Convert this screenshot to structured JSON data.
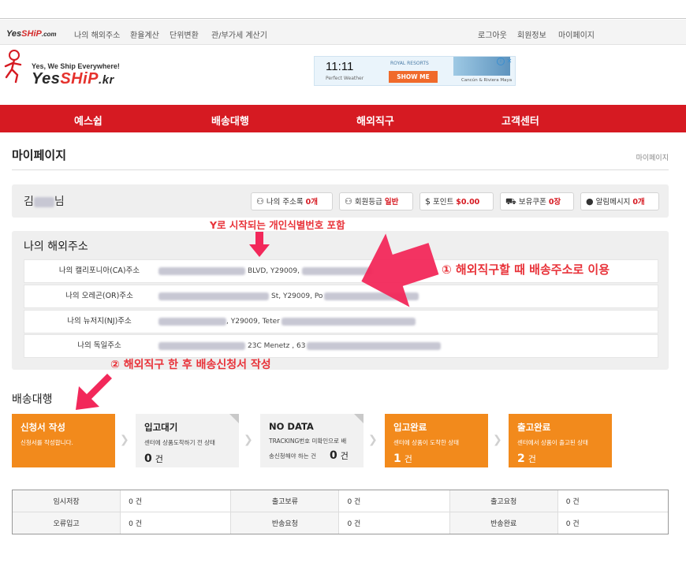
{
  "util_bar": {
    "logo": {
      "yes": "Yes",
      "ship": "SHiP",
      "com": ".com"
    },
    "left_links": [
      "나의 해외주소",
      "환율계산",
      "단위변환",
      "관/부가세 계산기"
    ],
    "right_links": [
      "로그아웃",
      "회원정보",
      "마이페이지"
    ]
  },
  "header": {
    "tagline": "Yes, We Ship Everywhere!",
    "logo": {
      "yes": "Yes",
      "ship": "SHiP",
      "kr": ".kr"
    }
  },
  "ad": {
    "time": "11:11",
    "weather": "Perfect Weather",
    "brand": "ROYAL RESORTS",
    "button": "SHOW ME",
    "sub": "Cancún & Riviera Maya"
  },
  "nav": [
    "예스쉽",
    "배송대행",
    "해외직구",
    "고객센터"
  ],
  "page": {
    "title": "마이페이지",
    "breadcrumb": "마이페이지"
  },
  "user": {
    "name_first": "김",
    "name_suffix": "님",
    "pills": [
      {
        "icon": "address-book-icon",
        "label": "나의 주소록",
        "value": "0개"
      },
      {
        "icon": "member-grade-icon",
        "label": "회원등급",
        "value": "일반"
      },
      {
        "icon": "point-coin-icon",
        "label": "포인트",
        "value": "$0.00"
      },
      {
        "icon": "coupon-icon",
        "label": "보유쿠폰",
        "value": "0장"
      },
      {
        "icon": "message-bubble-icon",
        "label": "알림메시지",
        "value": "0개"
      }
    ]
  },
  "addresses": {
    "title": "나의 해외주소",
    "rows": [
      {
        "label": "나의 캘리포니아(CA)주소",
        "visible": "BLVD, Y29009,"
      },
      {
        "label": "나의 오레곤(OR)주소",
        "visible": "St, Y29009, Po"
      },
      {
        "label": "나의 뉴저지(NJ)주소",
        "visible": ", Y29009, Teter"
      },
      {
        "label": "나의 독일주소",
        "visible": "23C Menetz , 63"
      }
    ]
  },
  "annotations": {
    "y_note": "Y로 시작되는 개인식별번호 포함",
    "note1": "① 해외직구할 때 배송주소로 이용",
    "note2": "② 해외직구 한 후 배송신청서 작성"
  },
  "delivery": {
    "title": "배송대행",
    "steps": [
      {
        "title": "신청서 작성",
        "desc1": "신청서를 작성합니다.",
        "desc2": "",
        "count": "",
        "unit": ""
      },
      {
        "title": "입고대기",
        "desc1": "센터에 상품도착하기 전 상태",
        "desc2": "",
        "count": "0",
        "unit": "건"
      },
      {
        "title": "NO DATA",
        "desc1": "TRACKING번호 미확인으로 배",
        "desc2": "송신청해야 하는 건",
        "count": "0",
        "unit": "건"
      },
      {
        "title": "입고완료",
        "desc1": "센터에 상품이 도착한 상태",
        "desc2": "",
        "count": "1",
        "unit": "건"
      },
      {
        "title": "출고완료",
        "desc1": "센터에서 상품이 출고된 상태",
        "desc2": "",
        "count": "2",
        "unit": "건"
      }
    ]
  },
  "status_table": [
    [
      {
        "label": "임시저장",
        "value": "0 건"
      },
      {
        "label": "출고보류",
        "value": "0 건"
      },
      {
        "label": "출고요청",
        "value": "0 건"
      }
    ],
    [
      {
        "label": "오류입고",
        "value": "0 건"
      },
      {
        "label": "반송요청",
        "value": "0 건"
      },
      {
        "label": "반송완료",
        "value": "0 건"
      }
    ]
  ],
  "colors": {
    "brand_red": "#d61a22",
    "step_orange": "#f28a1c",
    "annotation_red": "#e8333a",
    "arrow_pink": "#f2285a"
  }
}
